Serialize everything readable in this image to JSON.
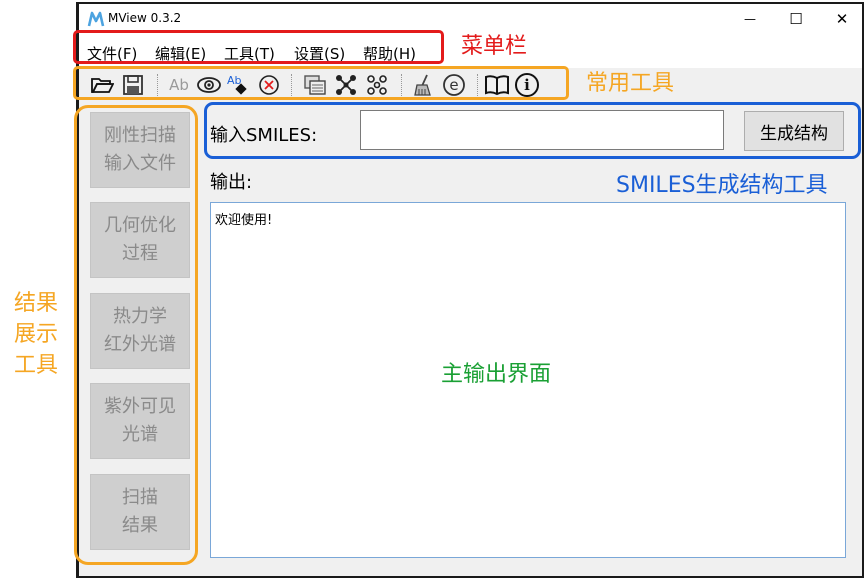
{
  "window": {
    "title": "MView 0.3.2",
    "minimize": "—",
    "maximize": "☐",
    "close": "✕"
  },
  "menu": [
    {
      "label": "文件(F)"
    },
    {
      "label": "编辑(E)"
    },
    {
      "label": "工具(T)"
    },
    {
      "label": "设置(S)"
    },
    {
      "label": "帮助(H)"
    }
  ],
  "toolbar": {
    "icons": [
      "open-folder-icon",
      "save-icon",
      "text-ab-icon",
      "eye-icon",
      "clear-label-icon",
      "cancel-circle-icon",
      "copy-structure-icon",
      "molecule-bonds-icon",
      "atoms-dots-icon",
      "broom-icon",
      "e-circle-icon",
      "book-icon",
      "info-icon"
    ],
    "text_icon": "Ab",
    "e_icon": "e",
    "info_icon": "i"
  },
  "sidebar": [
    {
      "line1": "刚性扫描",
      "line2": "输入文件"
    },
    {
      "line1": "几何优化",
      "line2": "过程"
    },
    {
      "line1": "热力学",
      "line2": "红外光谱"
    },
    {
      "line1": "紫外可见",
      "line2": "光谱"
    },
    {
      "line1": "扫描",
      "line2": "结果"
    }
  ],
  "smiles": {
    "label": "输入SMILES:",
    "value": "",
    "button": "生成结构"
  },
  "output": {
    "label": "输出:",
    "text": "欢迎使用!"
  },
  "annotations": {
    "menubar": "菜单栏",
    "toolbar": "常用工具",
    "smiles_tool": "SMILES生成结构工具",
    "results_tool_1": "结果",
    "results_tool_2": "展示",
    "results_tool_3": "工具",
    "main_output": "主输出界面"
  },
  "colors": {
    "red": "#e31b1b",
    "orange": "#f5a623",
    "blue": "#1a5fd6",
    "green": "#1aa034",
    "logo": "#4ca3e0"
  }
}
